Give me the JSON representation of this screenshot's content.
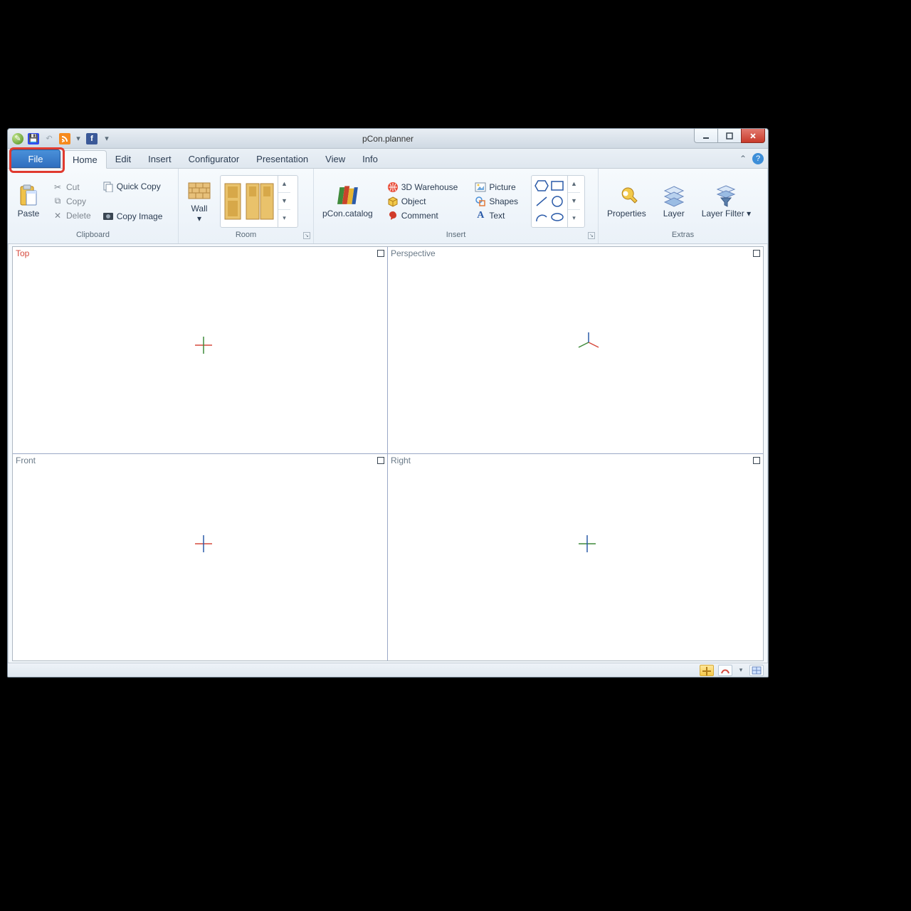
{
  "window": {
    "title": "pCon.planner"
  },
  "tabs": {
    "file": "File",
    "items": [
      "Home",
      "Edit",
      "Insert",
      "Configurator",
      "Presentation",
      "View",
      "Info"
    ]
  },
  "ribbon": {
    "clipboard": {
      "label": "Clipboard",
      "paste": "Paste",
      "cut": "Cut",
      "copy": "Copy",
      "delete": "Delete",
      "quick_copy": "Quick Copy",
      "copy_image": "Copy Image"
    },
    "room": {
      "label": "Room",
      "wall": "Wall"
    },
    "insert": {
      "label": "Insert",
      "pcon_catalog": "pCon.catalog",
      "warehouse": "3D Warehouse",
      "object": "Object",
      "comment": "Comment",
      "picture": "Picture",
      "shapes": "Shapes",
      "text": "Text"
    },
    "extras": {
      "label": "Extras",
      "properties": "Properties",
      "layer": "Layer",
      "layer_filter": "Layer\nFilter"
    }
  },
  "viewports": [
    "Top",
    "Perspective",
    "Front",
    "Right"
  ]
}
